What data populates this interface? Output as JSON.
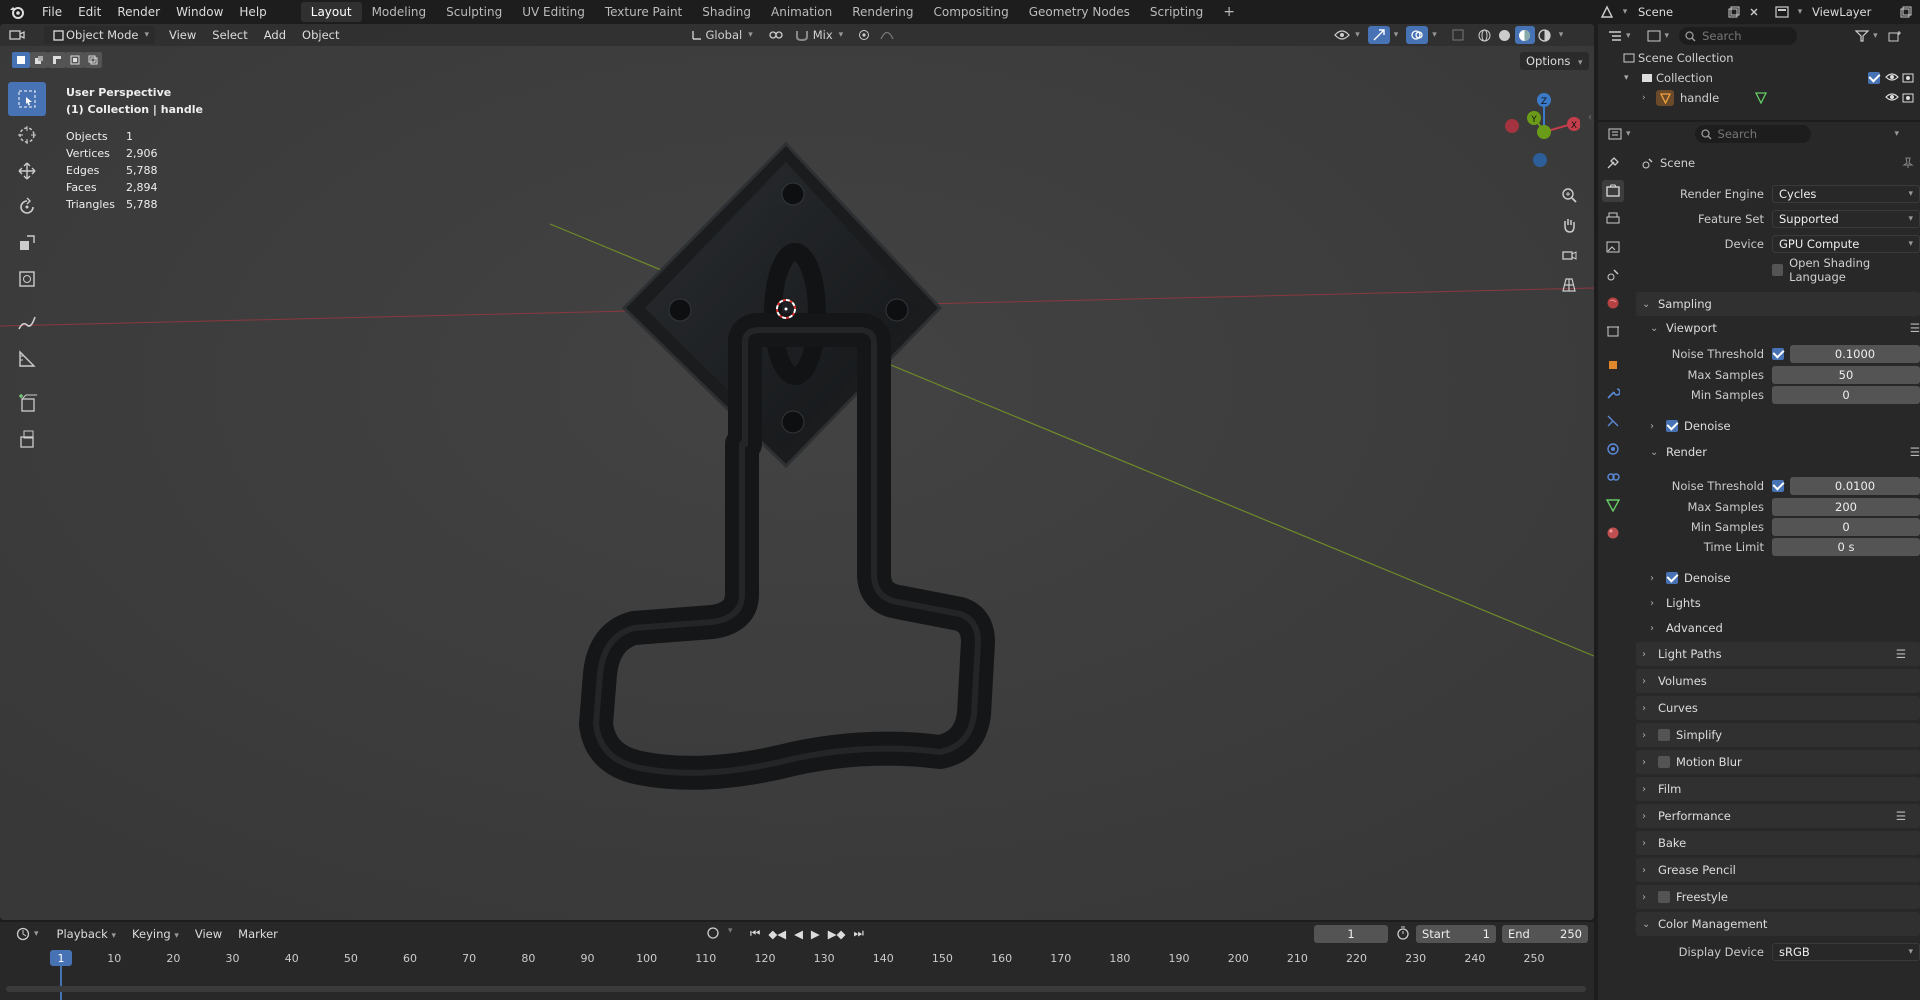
{
  "topbar": {
    "menus": [
      "File",
      "Edit",
      "Render",
      "Window",
      "Help"
    ],
    "workspaces": [
      {
        "label": "Layout",
        "active": true
      },
      {
        "label": "Modeling"
      },
      {
        "label": "Sculpting"
      },
      {
        "label": "UV Editing"
      },
      {
        "label": "Texture Paint"
      },
      {
        "label": "Shading"
      },
      {
        "label": "Animation"
      },
      {
        "label": "Rendering"
      },
      {
        "label": "Compositing"
      },
      {
        "label": "Geometry Nodes"
      },
      {
        "label": "Scripting"
      }
    ],
    "scene": "Scene",
    "viewlayer": "ViewLayer"
  },
  "viewport": {
    "mode": "Object Mode",
    "menus": [
      "View",
      "Select",
      "Add",
      "Object"
    ],
    "orientation": "Global",
    "snap": "Mix",
    "options": "Options",
    "info_title": "User Perspective",
    "info_sub": "(1) Collection | handle",
    "stats": [
      {
        "label": "Objects",
        "value": "1"
      },
      {
        "label": "Vertices",
        "value": "2,906"
      },
      {
        "label": "Edges",
        "value": "5,788"
      },
      {
        "label": "Faces",
        "value": "2,894"
      },
      {
        "label": "Triangles",
        "value": "5,788"
      }
    ],
    "gizmo": {
      "z": "Z",
      "y": "Y",
      "x": "X"
    }
  },
  "outliner": {
    "search_placeholder": "Search",
    "scene_collection": "Scene Collection",
    "collection": "Collection",
    "object": "handle"
  },
  "props": {
    "search_placeholder": "Search",
    "context": "Scene",
    "render_engine_label": "Render Engine",
    "render_engine": "Cycles",
    "feature_set_label": "Feature Set",
    "feature_set": "Supported",
    "device_label": "Device",
    "device": "GPU Compute",
    "osl_label": "Open Shading Language",
    "sampling": "Sampling",
    "viewport": "Viewport",
    "vp_noise_label": "Noise Threshold",
    "vp_noise": "0.1000",
    "vp_max_label": "Max Samples",
    "vp_max": "50",
    "vp_min_label": "Min Samples",
    "vp_min": "0",
    "denoise": "Denoise",
    "render": "Render",
    "r_noise_label": "Noise Threshold",
    "r_noise": "0.0100",
    "r_max_label": "Max Samples",
    "r_max": "200",
    "r_min_label": "Min Samples",
    "r_min": "0",
    "r_time_label": "Time Limit",
    "r_time": "0 s",
    "lights": "Lights",
    "advanced": "Advanced",
    "panels": [
      "Light Paths",
      "Volumes",
      "Curves",
      "Simplify",
      "Motion Blur",
      "Film",
      "Performance",
      "Bake",
      "Grease Pencil",
      "Freestyle",
      "Color Management"
    ],
    "display_device_label": "Display Device",
    "display_device": "sRGB"
  },
  "timeline": {
    "menus": [
      "Playback",
      "Keying",
      "View",
      "Marker"
    ],
    "current_frame": "1",
    "start_label": "Start",
    "start": "1",
    "end_label": "End",
    "end": "250",
    "ticks": [
      "1",
      "10",
      "20",
      "30",
      "40",
      "50",
      "60",
      "70",
      "80",
      "90",
      "100",
      "110",
      "120",
      "130",
      "140",
      "150",
      "160",
      "170",
      "180",
      "190",
      "200",
      "210",
      "220",
      "230",
      "240",
      "250"
    ]
  },
  "colors": {
    "accent": "#4772b3",
    "x_axis": "#c33d4a",
    "y_axis": "#6a9c1a",
    "z_axis": "#3b7ac8"
  }
}
